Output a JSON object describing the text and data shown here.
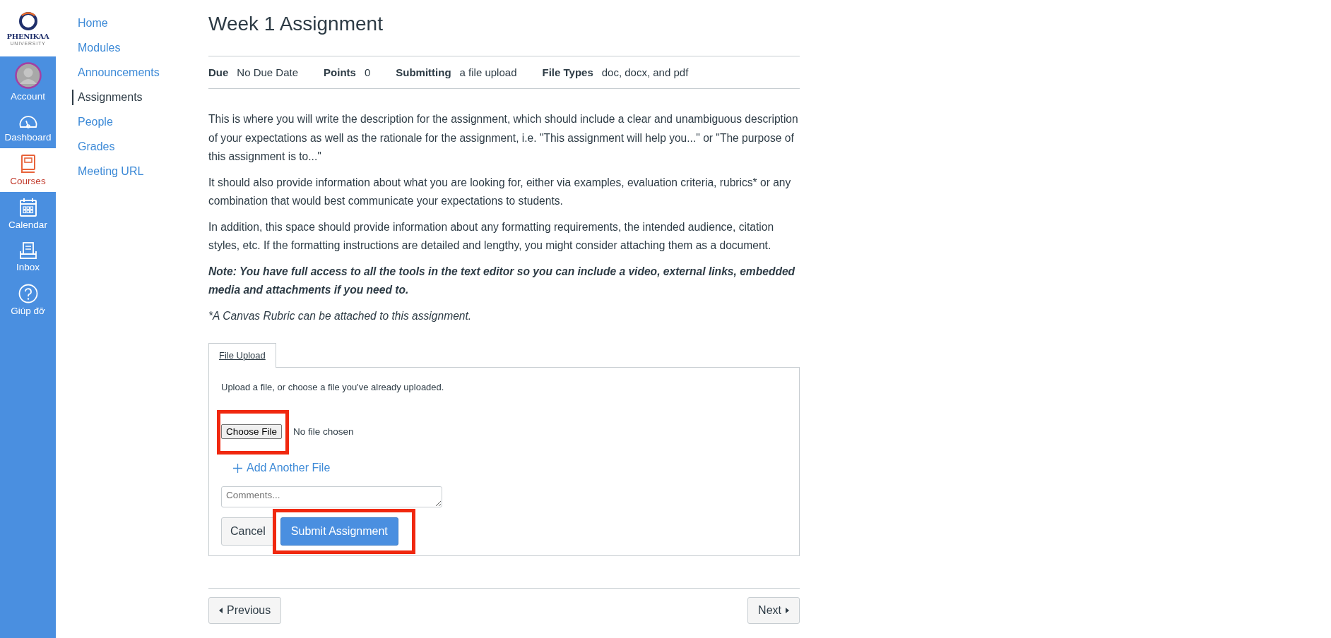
{
  "logo": {
    "name": "PHENIKAA",
    "subtitle": "UNIVERSITY"
  },
  "global_nav": [
    {
      "label": "Account",
      "selected": false
    },
    {
      "label": "Dashboard",
      "selected": false
    },
    {
      "label": "Courses",
      "selected": true
    },
    {
      "label": "Calendar",
      "selected": false
    },
    {
      "label": "Inbox",
      "selected": false
    },
    {
      "label": "Giúp đỡ",
      "selected": false
    }
  ],
  "course_nav": [
    {
      "label": "Home",
      "selected": false
    },
    {
      "label": "Modules",
      "selected": false
    },
    {
      "label": "Announcements",
      "selected": false
    },
    {
      "label": "Assignments",
      "selected": true
    },
    {
      "label": "People",
      "selected": false
    },
    {
      "label": "Grades",
      "selected": false
    },
    {
      "label": "Meeting URL",
      "selected": false
    }
  ],
  "title": "Week 1 Assignment",
  "details": [
    {
      "label": "Due",
      "value": "No Due Date"
    },
    {
      "label": "Points",
      "value": "0"
    },
    {
      "label": "Submitting",
      "value": "a file upload"
    },
    {
      "label": "File Types",
      "value": "doc, docx, and pdf"
    }
  ],
  "description": [
    {
      "kind": "plain",
      "text": "This is where you will write the description for the assignment, which should include a clear and unambiguous description of your expectations as well as the rationale for the assignment, i.e. \"This assignment will help you...\" or \"The purpose of this assignment is to...\""
    },
    {
      "kind": "plain",
      "text": "It should also provide information about what you are looking for, either via examples, evaluation criteria, rubrics* or any combination that would best communicate your expectations to  students."
    },
    {
      "kind": "plain",
      "text": "In addition, this space should provide information about any formatting requirements, the intended audience, citation styles, etc. If the formatting instructions are detailed and lengthy, you might consider attaching them as a document."
    },
    {
      "kind": "note",
      "text": "Note: You have full access to all the tools in the text editor so you can include a video, external links, embedded media and attachments if you need to."
    },
    {
      "kind": "footnote",
      "text": "*A Canvas Rubric can be attached to this assignment."
    }
  ],
  "submission": {
    "tab": "File Upload",
    "instructions": "Upload a file, or choose a file you've already uploaded.",
    "choose_file": {
      "label": "Choose File",
      "status": "No file chosen",
      "highlighted": true
    },
    "add_file": "Add Another File",
    "comments": {
      "placeholder": "Comments..."
    },
    "cancel": {
      "label": "Cancel"
    },
    "submit": {
      "label": "Submit Assignment",
      "highlighted": true
    }
  },
  "pager": {
    "previous": "Previous",
    "next": "Next"
  }
}
